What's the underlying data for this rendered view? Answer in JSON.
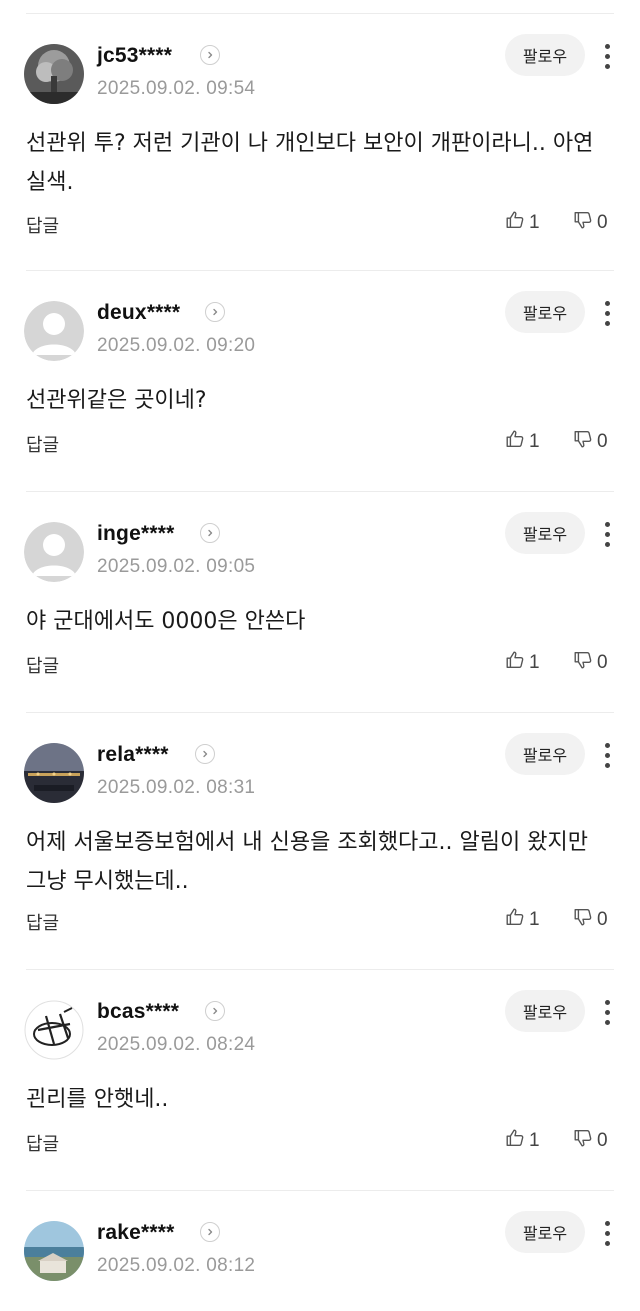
{
  "comments": [
    {
      "username": "jc53****",
      "timestamp": "2025.09.02. 09:54",
      "follow_label": "팔로우",
      "text": "선관위 투? 저런 기관이 나 개인보다 보안이 개판이라니.. 아연실색.",
      "reply_label": "답글",
      "likes": "1",
      "dislikes": "0",
      "avatar": "photo-smoke"
    },
    {
      "username": "deux****",
      "timestamp": "2025.09.02. 09:20",
      "follow_label": "팔로우",
      "text": "선관위같은 곳이네?",
      "reply_label": "답글",
      "likes": "1",
      "dislikes": "0",
      "avatar": "default-person"
    },
    {
      "username": "inge****",
      "timestamp": "2025.09.02. 09:05",
      "follow_label": "팔로우",
      "text": "야 군대에서도 0000은 안쓴다",
      "reply_label": "답글",
      "likes": "1",
      "dislikes": "0",
      "avatar": "default-person"
    },
    {
      "username": "rela****",
      "timestamp": "2025.09.02. 08:31",
      "follow_label": "팔로우",
      "text": "어제 서울보증보험에서 내 신용을 조회했다고.. 알림이 왔지만 그냥 무시했는데..",
      "reply_label": "답글",
      "likes": "1",
      "dislikes": "0",
      "avatar": "photo-night"
    },
    {
      "username": "bcas****",
      "timestamp": "2025.09.02. 08:24",
      "follow_label": "팔로우",
      "text": "괸리를 안햇네..",
      "reply_label": "답글",
      "likes": "1",
      "dislikes": "0",
      "avatar": "logo-sketch"
    },
    {
      "username": "rake****",
      "timestamp": "2025.09.02. 08:12",
      "follow_label": "팔로우",
      "avatar": "photo-beach"
    }
  ],
  "colors": {
    "follow_bg": "#f2f2f2",
    "timestamp": "#9a9a9a",
    "divider": "#ececec"
  }
}
